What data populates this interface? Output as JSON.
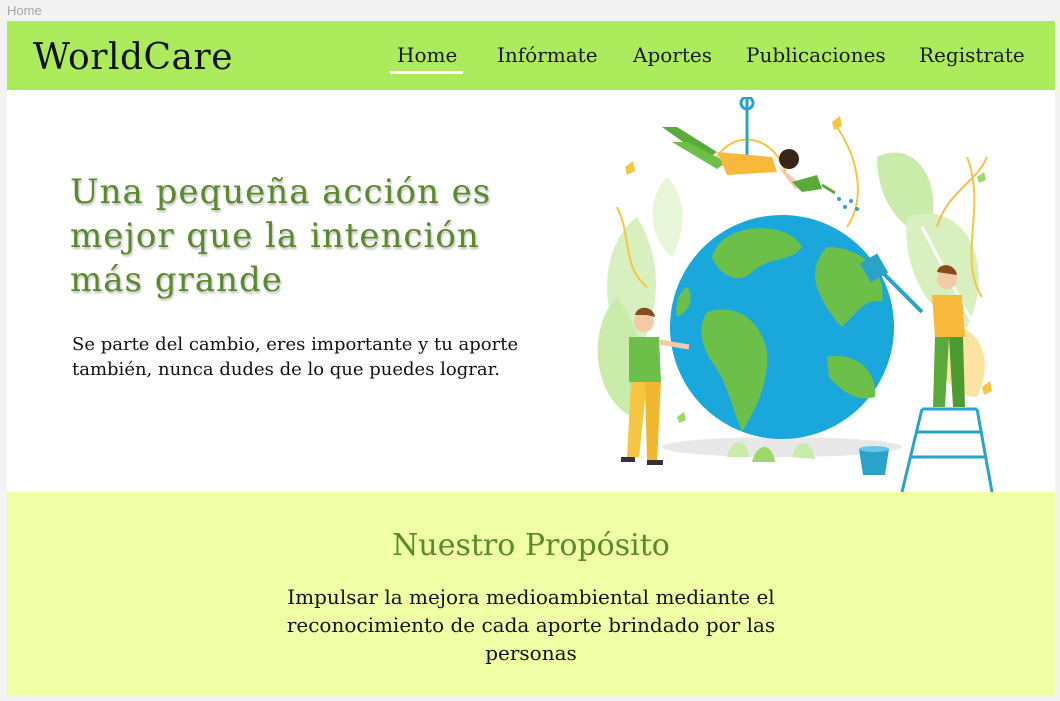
{
  "tab": {
    "label": "Home"
  },
  "navbar": {
    "brand": "WorldCare",
    "items": [
      {
        "label": "Home",
        "active": true
      },
      {
        "label": "Infórmate"
      },
      {
        "label": "Aportes"
      },
      {
        "label": "Publicaciones"
      },
      {
        "label": "Registrate"
      }
    ]
  },
  "hero": {
    "title": "Una pequeña acción es mejor que la intención más grande",
    "text": "Se parte del cambio, eres importante y tu aporte también, nunca dudes de lo que puedes lograr."
  },
  "purpose": {
    "title": "Nuestro Propósito",
    "text": "Impulsar la mejora medioambiental mediante el reconocimiento de cada aporte brindado por las personas"
  },
  "colors": {
    "navbar_bg": "#acec5c",
    "accent_green": "#5b8a2c",
    "purpose_bg": "#f0fea6",
    "globe_ocean": "#1aa8dc",
    "globe_land": "#6cc04a"
  }
}
